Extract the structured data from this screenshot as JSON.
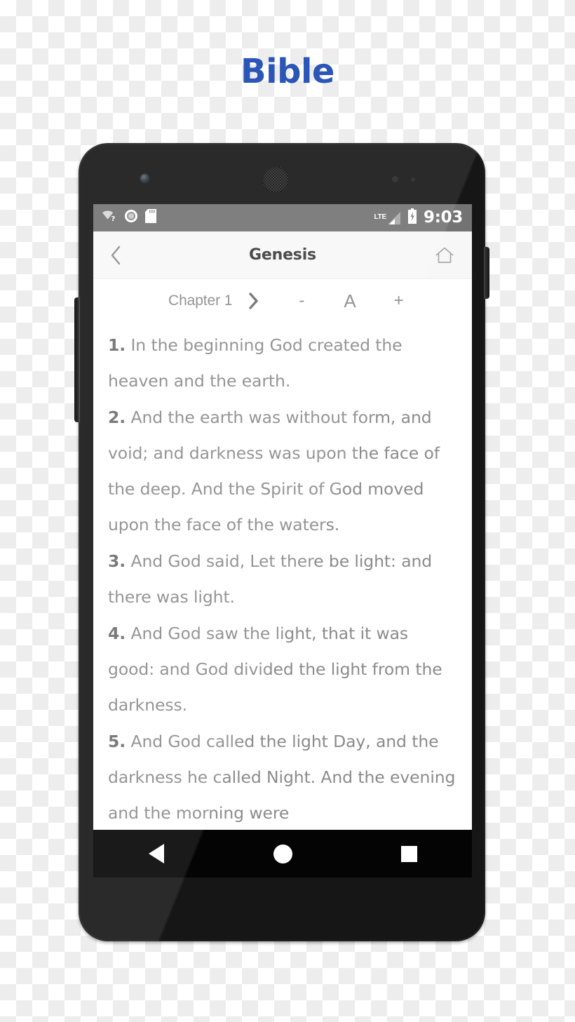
{
  "app": {
    "title": "Bible"
  },
  "status_bar": {
    "clock": "9:03",
    "network_label": "LTE",
    "icons": {
      "wifi": "wifi-question-icon",
      "ring": "ring-icon",
      "sd_card": "sd-card-icon",
      "signal": "signal-triangle-icon",
      "battery": "battery-charging-icon"
    }
  },
  "app_bar": {
    "title": "Genesis",
    "back_icon": "chevron-left-icon",
    "home_icon": "home-icon"
  },
  "chapter_bar": {
    "chapter_label": "Chapter 1",
    "next_icon": "chevron-right-icon",
    "decrease_label": "-",
    "font_label": "A",
    "increase_label": "+"
  },
  "verses": [
    {
      "number": "1.",
      "text": "In the beginning God created the heaven and the earth."
    },
    {
      "number": "2.",
      "text": "And the earth was without form, and void; and darkness was upon the face of the deep. And the Spirit of God moved upon the face of the waters."
    },
    {
      "number": "3.",
      "text": "And God said, Let there be light: and there was light."
    },
    {
      "number": "4.",
      "text": "And God saw the light, that it was good: and God divided the light from the darkness."
    },
    {
      "number": "5.",
      "text": "And God called the light Day, and the darkness he called Night. And the evening and the morning were"
    }
  ],
  "nav_bar": {
    "back": "back-triangle-icon",
    "home": "home-circle-icon",
    "recents": "recents-square-icon"
  },
  "colors": {
    "title_blue": "#2b55b7",
    "status_bar_gray": "#737373",
    "body_text_gray": "#8b8b8b"
  }
}
